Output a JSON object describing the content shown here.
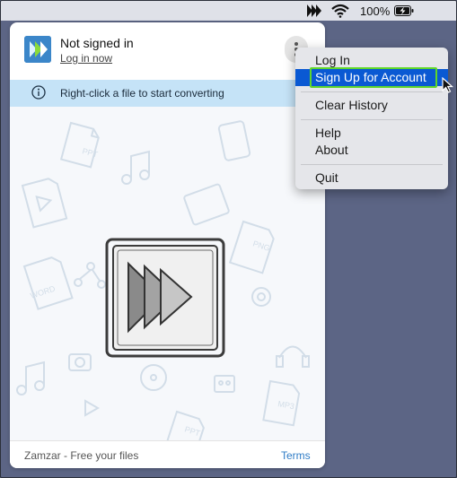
{
  "menubar": {
    "battery_percent": "100%"
  },
  "panel": {
    "user_title": "Not signed in",
    "login_link": "Log in now",
    "notice": "Right-click a file to start converting",
    "footer_text": "Zamzar - Free your files",
    "terms_link": "Terms"
  },
  "menu": {
    "items": [
      "Log In",
      "Sign Up for Account",
      "Clear History",
      "Help",
      "About",
      "Quit"
    ],
    "selected": "Sign Up for Account"
  },
  "dropzone": {
    "doodle_labels": [
      "PPT",
      "PNG",
      "WORD",
      "MP3",
      "PPT"
    ]
  },
  "colors": {
    "accent": "#0a59d3",
    "notice_bg": "#c5e3f7",
    "link": "#2f7cc6",
    "highlight": "#5fd62a"
  }
}
